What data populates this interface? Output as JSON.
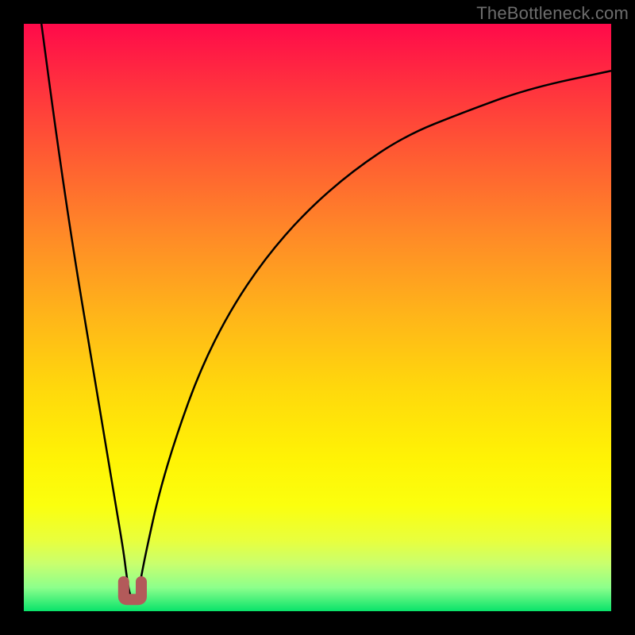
{
  "watermark": "TheBottleneck.com",
  "chart_data": {
    "type": "line",
    "title": "",
    "xlabel": "",
    "ylabel": "",
    "xlim": [
      0,
      100
    ],
    "ylim": [
      0,
      100
    ],
    "x": [
      3,
      5,
      7,
      9,
      11,
      13,
      15,
      16,
      17,
      17.5,
      18,
      18.5,
      19,
      19.5,
      20,
      21,
      23,
      26,
      30,
      35,
      41,
      48,
      56,
      65,
      75,
      86,
      100
    ],
    "values": [
      100,
      85,
      71,
      58,
      46,
      34,
      22,
      16,
      10,
      6,
      3,
      2,
      2,
      3,
      6,
      11,
      20,
      30,
      41,
      51,
      60,
      68,
      75,
      81,
      85,
      89,
      92
    ],
    "notch": {
      "x_center": 18.5,
      "y": 2,
      "width": 3,
      "color": "#b35a5a"
    },
    "gradient_stops": [
      {
        "pos": 0,
        "color": "#ff0a4a"
      },
      {
        "pos": 50,
        "color": "#ffb619"
      },
      {
        "pos": 100,
        "color": "#09e36a"
      }
    ]
  }
}
